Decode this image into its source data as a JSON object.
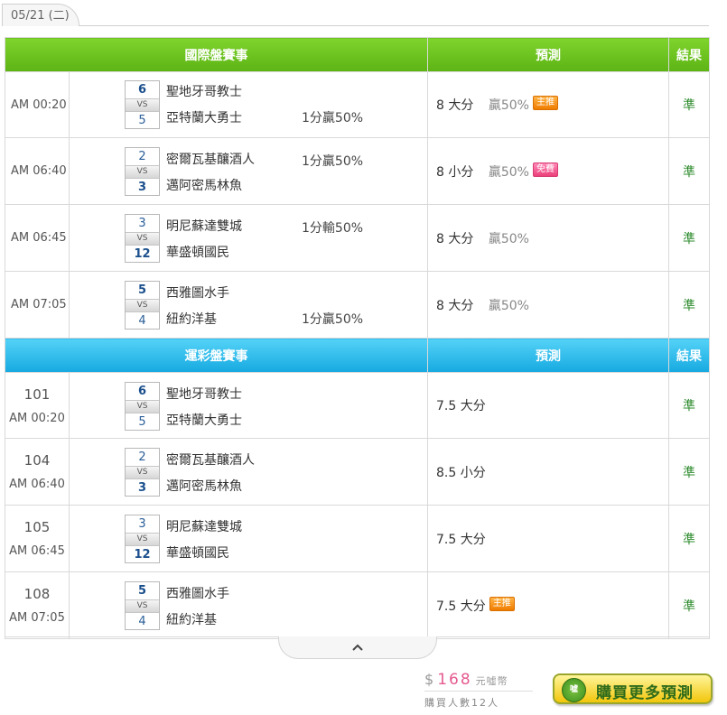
{
  "date_tab": "05/21 (二)",
  "sections": [
    {
      "title": "國際盤賽事",
      "pred_header": "預測",
      "result_header": "結果",
      "matches": [
        {
          "time": "AM 00:20",
          "score_top": "6",
          "score_bottom": "5",
          "team_top": "聖地牙哥教士",
          "team_bottom": "亞特蘭大勇士",
          "handicap": "1分贏50%",
          "handicap_row": "bottom",
          "pred_num": "8",
          "pred_pick": "大分",
          "pred_win": "贏50%",
          "badge": "主推",
          "result": "準"
        },
        {
          "time": "AM 06:40",
          "score_top": "2",
          "score_bottom": "3",
          "team_top": "密爾瓦基釀酒人",
          "team_bottom": "邁阿密馬林魚",
          "handicap": "1分贏50%",
          "handicap_row": "top",
          "pred_num": "8",
          "pred_pick": "小分",
          "pred_win": "贏50%",
          "badge": "免費",
          "result": "準"
        },
        {
          "time": "AM 06:45",
          "score_top": "3",
          "score_bottom": "12",
          "team_top": "明尼蘇達雙城",
          "team_bottom": "華盛頓國民",
          "handicap": "1分輸50%",
          "handicap_row": "top",
          "pred_num": "8",
          "pred_pick": "大分",
          "pred_win": "贏50%",
          "badge": "",
          "result": "準"
        },
        {
          "time": "AM 07:05",
          "score_top": "5",
          "score_bottom": "4",
          "team_top": "西雅圖水手",
          "team_bottom": "紐約洋基",
          "handicap": "1分贏50%",
          "handicap_row": "bottom",
          "pred_num": "8",
          "pred_pick": "大分",
          "pred_win": "贏50%",
          "badge": "",
          "result": "準"
        }
      ]
    },
    {
      "title": "運彩盤賽事",
      "pred_header": "預測",
      "result_header": "結果",
      "matches": [
        {
          "code": "101",
          "time": "AM 00:20",
          "score_top": "6",
          "score_bottom": "5",
          "team_top": "聖地牙哥教士",
          "team_bottom": "亞特蘭大勇士",
          "pred": "7.5 大分",
          "badge": "",
          "result": "準"
        },
        {
          "code": "104",
          "time": "AM 06:40",
          "score_top": "2",
          "score_bottom": "3",
          "team_top": "密爾瓦基釀酒人",
          "team_bottom": "邁阿密馬林魚",
          "pred": "8.5 小分",
          "badge": "",
          "result": "準"
        },
        {
          "code": "105",
          "time": "AM 06:45",
          "score_top": "3",
          "score_bottom": "12",
          "team_top": "明尼蘇達雙城",
          "team_bottom": "華盛頓國民",
          "pred": "7.5 大分",
          "badge": "",
          "result": "準"
        },
        {
          "code": "108",
          "time": "AM 07:05",
          "score_top": "5",
          "score_bottom": "4",
          "team_top": "西雅圖水手",
          "team_bottom": "紐約洋基",
          "pred": "7.5 大分",
          "badge": "主推",
          "result": "準"
        }
      ]
    }
  ],
  "vs_label": "VS",
  "collapse_icon": "chevron-up-icon",
  "price": {
    "currency": "$",
    "amount": "168",
    "unit": "元噓幣"
  },
  "buyers": "購買人數12人",
  "buy_button": {
    "label": "購買更多預測",
    "coin_text": "噓"
  },
  "colors": {
    "green_header": "#5cb314",
    "blue_header": "#16a9e0",
    "result_green": "#2e8b2e",
    "badge_orange": "#ef7d00",
    "badge_pink": "#ec407a",
    "price_pink": "#e55a8f"
  }
}
